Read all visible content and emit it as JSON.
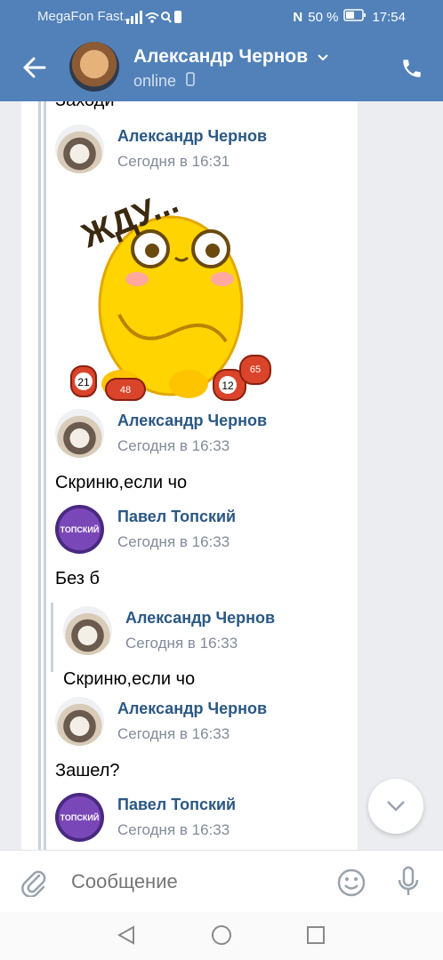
{
  "status_bar": {
    "carrier": "MegaFon Fast...",
    "battery": "50 %",
    "time": "17:54"
  },
  "header": {
    "name": "Александр Чернов",
    "status": "online"
  },
  "chat": {
    "top_text": "Заходи",
    "messages": [
      {
        "author": "Александр Чернов",
        "time": "Сегодня в 16:31",
        "sticker_text": "ЖДУ...",
        "sticker_numbers": [
          "21",
          "12",
          "48",
          "65"
        ]
      },
      {
        "author": "Александр Чернов",
        "time": "Сегодня в 16:33",
        "text": "Скриню,если чо"
      },
      {
        "author": "Павел Топский",
        "time": "Сегодня в 16:33",
        "text": "Без б",
        "avatar_text": "ТОПСКИЙ"
      },
      {
        "author": "Александр Чернов",
        "time": "Сегодня в 16:33",
        "text": "Скриню,если чо"
      },
      {
        "author": "Александр Чернов",
        "time": "Сегодня в 16:33",
        "text": "Зашел?"
      },
      {
        "author": "Павел Топский",
        "time": "Сегодня в 16:33",
        "avatar_text": "ТОПСКИЙ"
      }
    ]
  },
  "input": {
    "placeholder": "Сообщение"
  },
  "icons": {
    "back": "arrow-left-icon",
    "phone": "phone-icon",
    "attach": "paperclip-icon",
    "emoji": "smile-icon",
    "mic": "microphone-icon",
    "scroll": "chevron-down-icon"
  },
  "colors": {
    "header": "#5181b8",
    "author": "#2a5885",
    "time": "#828a99"
  }
}
